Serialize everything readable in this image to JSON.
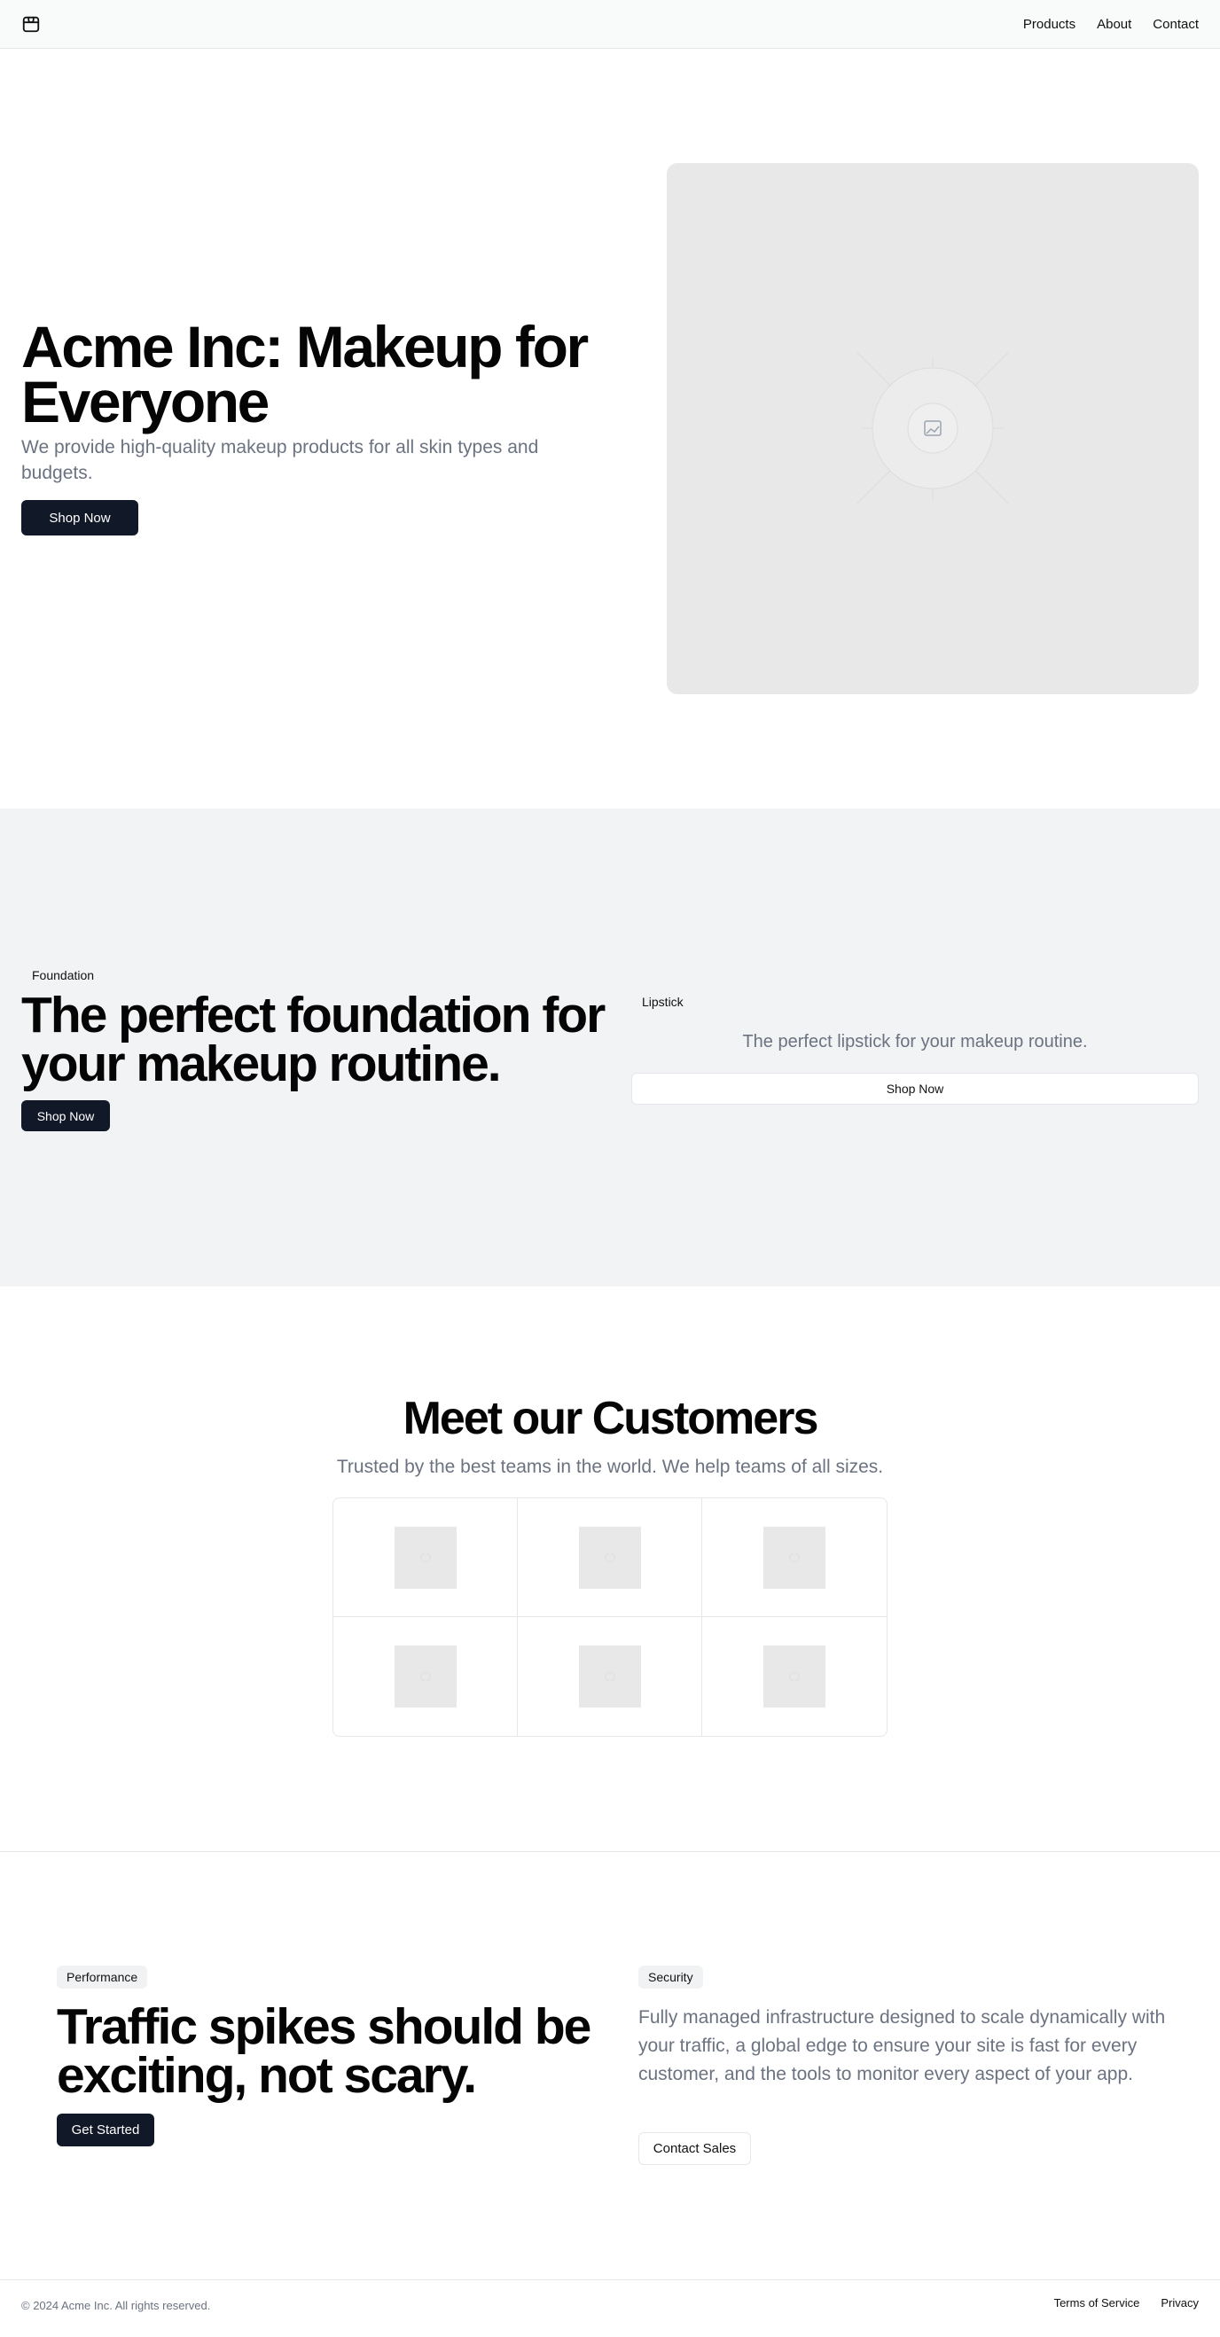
{
  "header": {
    "logo_icon": "package-icon",
    "nav": [
      "Products",
      "About",
      "Contact"
    ]
  },
  "hero": {
    "title": "Acme Inc: Makeup for Everyone",
    "subtitle": "We provide high-quality makeup products for all skin types and budgets.",
    "button": "Shop Now",
    "image_icon": "image-placeholder-icon"
  },
  "foundation": {
    "tag": "Foundation",
    "title": "The perfect foundation for your makeup routine.",
    "button": "Shop Now"
  },
  "lipstick": {
    "tag": "Lipstick",
    "description": "The perfect lipstick for your makeup routine.",
    "button": "Shop Now"
  },
  "customers": {
    "title": "Meet our Customers",
    "subtitle": "Trusted by the best teams in the world. We help teams of all sizes.",
    "logo_count": 6
  },
  "performance": {
    "tag": "Performance",
    "title": "Traffic spikes should be exciting, not scary.",
    "button": "Get Started"
  },
  "security": {
    "tag": "Security",
    "description": "Fully managed infrastructure designed to scale dynamically with your traffic, a global edge to ensure your site is fast for every customer, and the tools to monitor every aspect of your app.",
    "button": "Contact Sales"
  },
  "footer": {
    "copyright": "© 2024 Acme Inc. All rights reserved.",
    "links": [
      "Terms of Service",
      "Privacy"
    ]
  },
  "colors": {
    "primary_button": "#111827",
    "muted_text": "#6b7280",
    "band_bg": "#f2f3f5",
    "placeholder": "#e8e8e8"
  }
}
